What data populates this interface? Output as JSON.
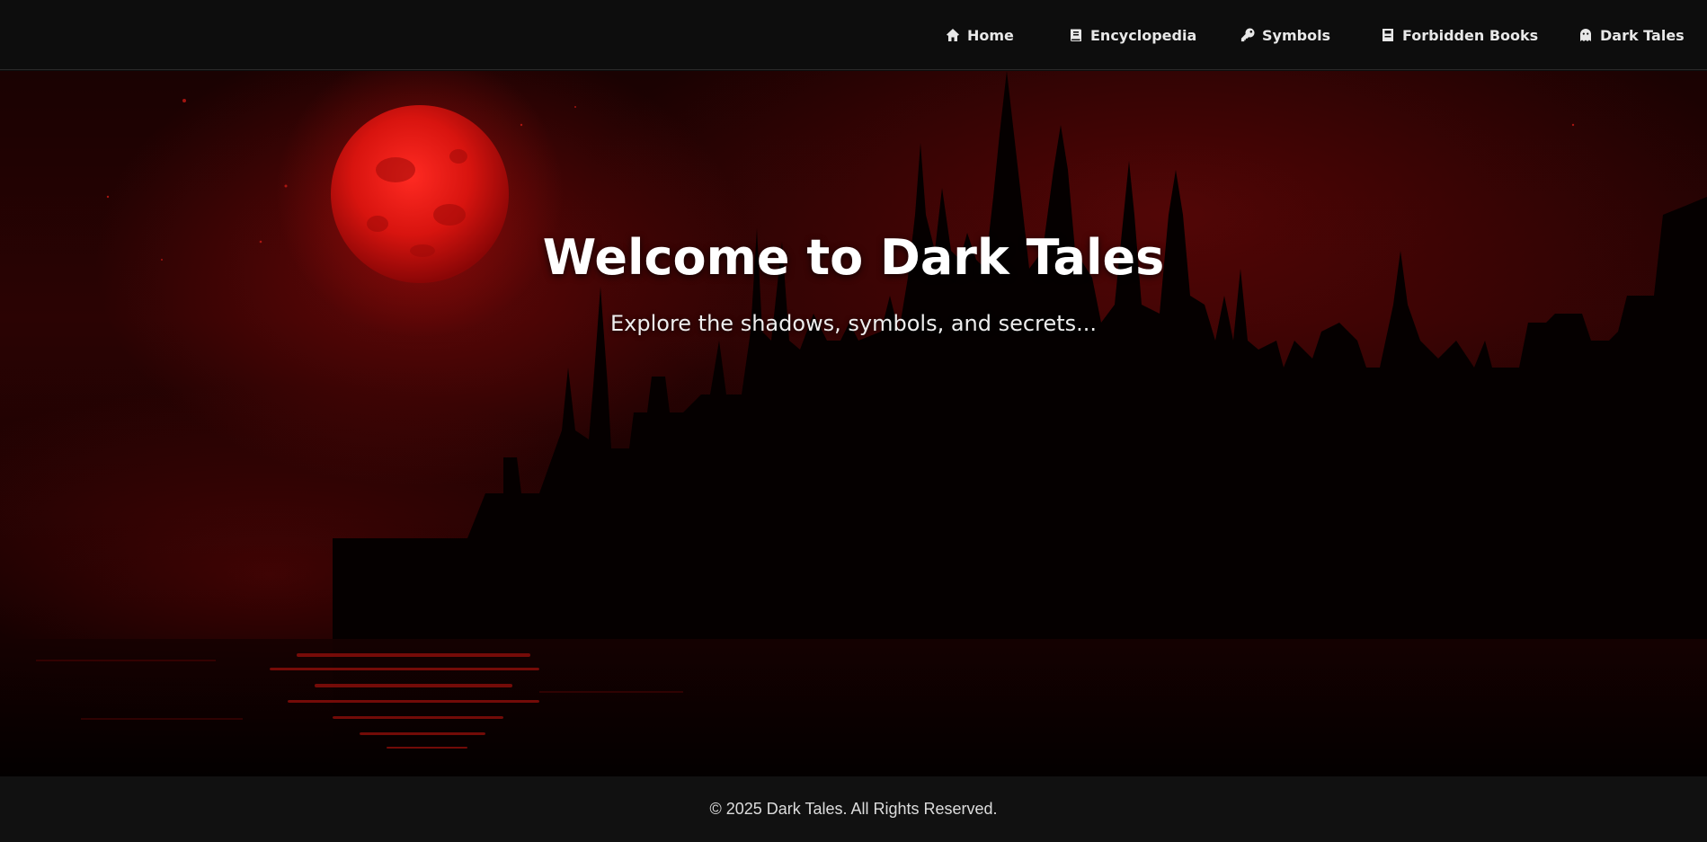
{
  "nav": {
    "items": [
      {
        "label": "Home",
        "icon": "home-icon"
      },
      {
        "label": "Encyclopedia",
        "icon": "book-icon"
      },
      {
        "label": "Symbols",
        "icon": "key-icon"
      },
      {
        "label": "Forbidden Books",
        "icon": "closed-book-icon"
      },
      {
        "label": "Dark Tales",
        "icon": "ghost-icon"
      }
    ]
  },
  "hero": {
    "title": "Welcome to Dark Tales",
    "subtitle": "Explore the shadows, symbols, and secrets..."
  },
  "footer": {
    "copyright": "© 2025 Dark Tales. All Rights Reserved."
  },
  "colors": {
    "accent": "#d41414",
    "background": "#0c0c0c",
    "footer": "#111111"
  }
}
